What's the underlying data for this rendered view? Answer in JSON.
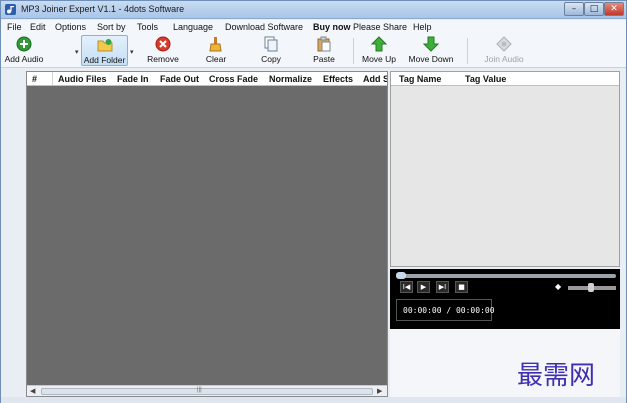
{
  "window": {
    "title": "MP3 Joiner Expert V1.1 - 4dots Software",
    "controls": {
      "minimize": "–",
      "maximize": "□",
      "close": "✕"
    }
  },
  "menu": [
    "File",
    "Edit",
    "Options",
    "Sort by",
    "Tools",
    "Language",
    "Download Software",
    "Buy now",
    "Please Share",
    "Help"
  ],
  "toolbar": [
    {
      "label": "Add Audio",
      "icon": "add-circle-icon"
    },
    {
      "label": "Add Folder",
      "icon": "folder-icon"
    },
    {
      "label": "Remove",
      "icon": "remove-circle-icon"
    },
    {
      "label": "Clear",
      "icon": "broom-icon"
    },
    {
      "label": "Copy",
      "icon": "copy-icon"
    },
    {
      "label": "Paste",
      "icon": "paste-icon"
    },
    {
      "label": "Move Up",
      "icon": "arrow-up-icon"
    },
    {
      "label": "Move Down",
      "icon": "arrow-down-icon"
    },
    {
      "label": "Join Audio",
      "icon": "join-icon"
    }
  ],
  "files_table": {
    "columns": [
      "#",
      "Audio Files",
      "Fade In",
      "Fade Out",
      "Cross Fade",
      "Normalize",
      "Effects",
      "Add S"
    ],
    "rows": []
  },
  "tags_table": {
    "columns": [
      "Tag Name",
      "Tag Value"
    ],
    "rows": []
  },
  "player": {
    "time": "00:00:00 / 00:00:00",
    "buttons": [
      "I◀",
      "▶",
      "▶I",
      "■"
    ],
    "volume_icon": "◆"
  },
  "watermark": "最需网",
  "colors": {
    "list_background": "#6b6b6b",
    "player_background": "#000000",
    "watermark": "#3d2fae"
  }
}
